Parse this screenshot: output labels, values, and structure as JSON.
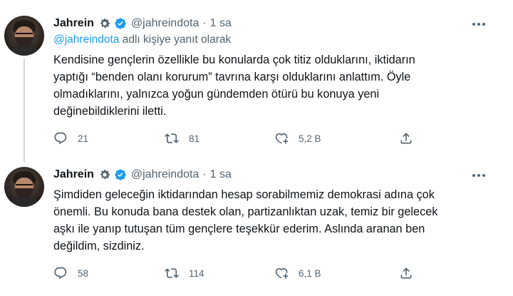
{
  "tweets": [
    {
      "author_name": "Jahrein",
      "handle": "@jahreindota",
      "dot": "·",
      "time": "1 sa",
      "reply_mention": "@jahreindota",
      "reply_suffix": " adlı kişiye yanıt olarak",
      "text": "Kendisine gençlerin özellikle bu konularda çok titiz olduklarını, iktidarın\nyaptığı “benden olanı korurum” tavrına karşı olduklarını anlattım. Öyle\nolmadıklarını, yalnızca yoğun gündemden ötürü bu konuya yeni\ndeğinebildiklerini iletti.",
      "replies": "21",
      "retweets": "81",
      "likes": "5,2 B"
    },
    {
      "author_name": "Jahrein",
      "handle": "@jahreindota",
      "dot": "·",
      "time": "1 sa",
      "text": "Şimdiden geleceğin iktidarından hesap sorabilmemiz demokrasi adına çok\nönemli. Bu konuda bana destek olan, partizanlıktan uzak, temiz bir gelecek\naşkı ile yanıp tutuşan tüm gençlere teşekkür ederim. Aslında aranan ben\ndeğildim, sizdiniz.",
      "replies": "58",
      "retweets": "114",
      "likes": "6,1 B"
    }
  ],
  "colors": {
    "text": "#0f1419",
    "secondary": "#536471",
    "accent": "#1d9bf0",
    "thread_line": "#cfd9de"
  },
  "icons": [
    "gear-icon",
    "verified-badge-icon",
    "more-icon",
    "reply-icon",
    "retweet-icon",
    "like-icon",
    "share-icon"
  ]
}
